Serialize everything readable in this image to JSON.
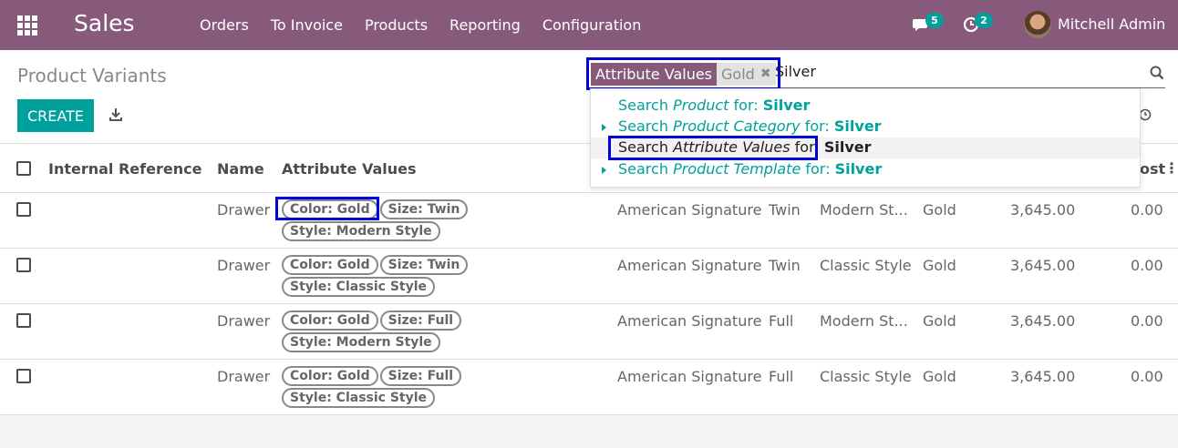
{
  "navbar": {
    "app_name": "Sales",
    "menu": [
      "Orders",
      "To Invoice",
      "Products",
      "Reporting",
      "Configuration"
    ],
    "messages_count": "5",
    "activities_count": "2",
    "user_name": "Mitchell Admin"
  },
  "control_panel": {
    "breadcrumb": "Product Variants",
    "create_label": "CREATE"
  },
  "search": {
    "facet_label": "Attribute Values",
    "facet_value": "Gold",
    "facet_remove": "✖",
    "query": "Silver",
    "suggestions": [
      {
        "prefix": "Search ",
        "field": "Product",
        "mid": " for: ",
        "value": "Silver",
        "expandable": false,
        "active": false
      },
      {
        "prefix": "Search ",
        "field": "Product Category",
        "mid": " for: ",
        "value": "Silver",
        "expandable": true,
        "active": false
      },
      {
        "prefix": "Search ",
        "field": "Attribute Values",
        "mid": " for: ",
        "value": "Silver",
        "expandable": false,
        "active": true
      },
      {
        "prefix": "Search ",
        "field": "Product Template",
        "mid": " for: ",
        "value": "Silver",
        "expandable": true,
        "active": false
      }
    ]
  },
  "table": {
    "headers": [
      "Internal Reference",
      "Name",
      "Attribute Values",
      "ost"
    ],
    "rows": [
      {
        "name": "Drawer",
        "tags": [
          "Color: Gold",
          "Size: Twin",
          "Style: Modern Style"
        ],
        "template": "American Signature",
        "size": "Twin",
        "style": "Modern St...",
        "color": "Gold",
        "price": "3,645.00",
        "cost": "0.00"
      },
      {
        "name": "Drawer",
        "tags": [
          "Color: Gold",
          "Size: Twin",
          "Style: Classic Style"
        ],
        "template": "American Signature",
        "size": "Twin",
        "style": "Classic Style",
        "color": "Gold",
        "price": "3,645.00",
        "cost": "0.00"
      },
      {
        "name": "Drawer",
        "tags": [
          "Color: Gold",
          "Size: Full",
          "Style: Modern Style"
        ],
        "template": "American Signature",
        "size": "Full",
        "style": "Modern St...",
        "color": "Gold",
        "price": "3,645.00",
        "cost": "0.00"
      },
      {
        "name": "Drawer",
        "tags": [
          "Color: Gold",
          "Size: Full",
          "Style: Classic Style"
        ],
        "template": "American Signature",
        "size": "Full",
        "style": "Classic Style",
        "color": "Gold",
        "price": "3,645.00",
        "cost": "0.00"
      }
    ]
  },
  "colors": {
    "brand": "#875a7b",
    "accent": "#00a09d",
    "highlight": "#0000dd"
  }
}
